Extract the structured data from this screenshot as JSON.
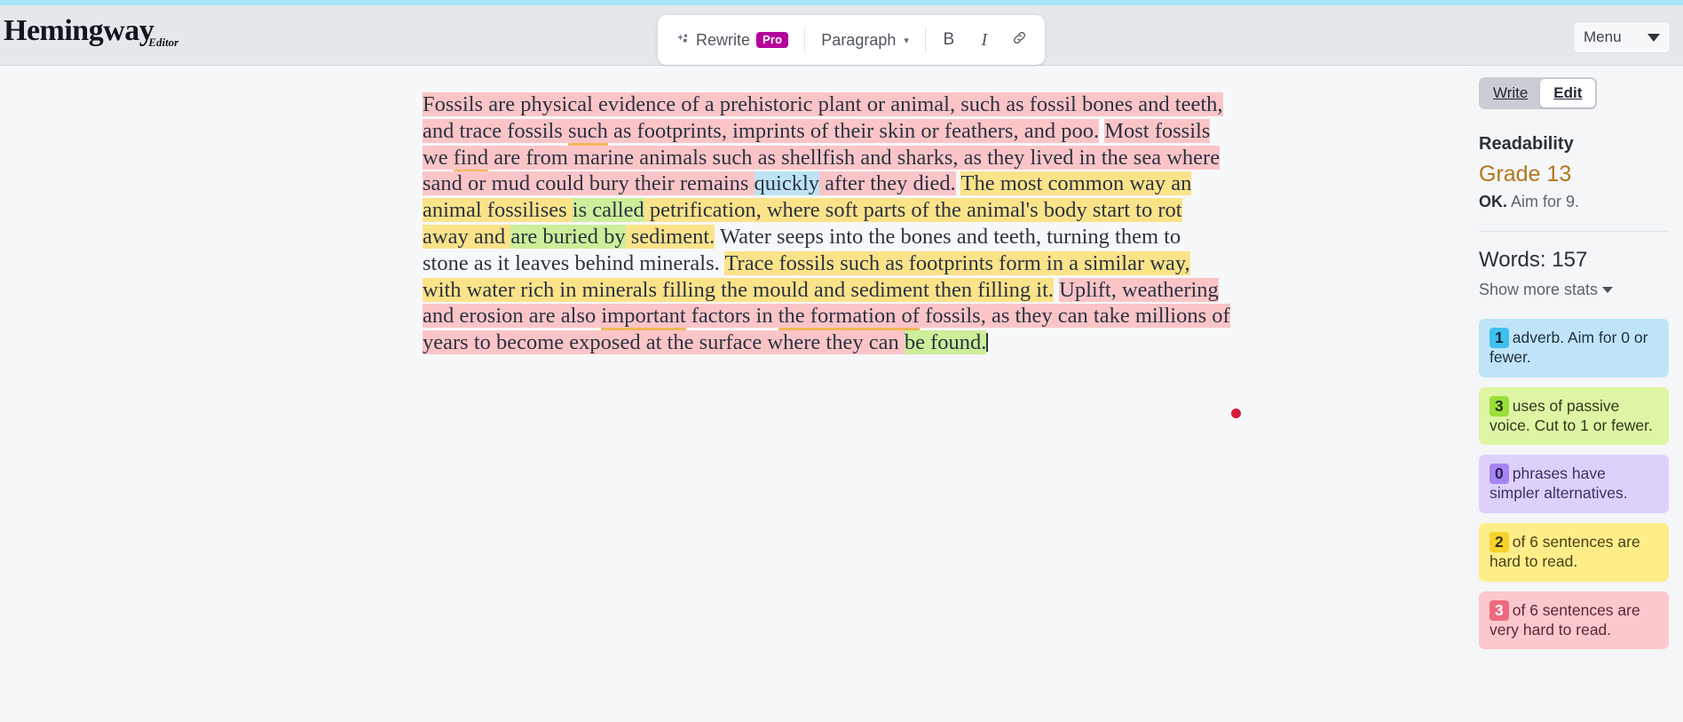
{
  "app": {
    "logo_name": "Hemingway",
    "logo_sub": "Editor"
  },
  "toolbar": {
    "rewrite_label": "Rewrite",
    "pro_badge": "Pro",
    "paragraph_label": "Paragraph",
    "bold_label": "B",
    "italic_label": "I",
    "link_icon": "link-icon",
    "sparkle_icon": "sparkle-icon",
    "chevron_icon": "chevron-down-icon"
  },
  "menu": {
    "label": "Menu"
  },
  "sidebar": {
    "toggle": {
      "write_label": "Write",
      "edit_label": "Edit",
      "active": "Edit"
    },
    "readability_title": "Readability",
    "grade": "Grade 13",
    "grade_status": "OK.",
    "grade_aim": "Aim for 9.",
    "words_label": "Words: 157",
    "show_more_label": "Show more stats",
    "cards": [
      {
        "count": "1",
        "text": "adverb. Aim for 0 or fewer.",
        "kind": "adverb"
      },
      {
        "count": "3",
        "text": "uses of passive voice. Cut to 1 or fewer.",
        "kind": "passive"
      },
      {
        "count": "0",
        "text": "phrases have simpler alternatives.",
        "kind": "simpler"
      },
      {
        "count": "2",
        "text": "of 6 sentences are hard to read.",
        "kind": "hard"
      },
      {
        "count": "3",
        "text": "of 6 sentences are very hard to read.",
        "kind": "vhard"
      }
    ]
  },
  "colors": {
    "very_hard": "#fbc5c8",
    "hard": "#fbe38a",
    "adverb": "#bde3f5",
    "passive": "#cdee9a",
    "simpler_underline": "#f0b858",
    "grade": "#b3761b",
    "pro_badge": "#b5009a",
    "accent_strip": "#a9e4f7",
    "cursor_dot": "#d61b37"
  },
  "document": {
    "segments": [
      {
        "text": "Fossils are physical evidence of a prehistoric plant or animal, such as fossil bones and teeth, and trace fossils ",
        "style": "very-hard"
      },
      {
        "text": "such",
        "style": "very-hard-underline"
      },
      {
        "text": " as footprints, imprints of their skin or feathers, and poo.",
        "style": "very-hard"
      },
      {
        "text": " ",
        "style": "none"
      },
      {
        "text": "Most fossils we ",
        "style": "very-hard"
      },
      {
        "text": "find",
        "style": "very-hard-underline"
      },
      {
        "text": " are from marine animals such as shellfish and sharks, as they lived in the sea where sand or mud could bury their remains ",
        "style": "very-hard"
      },
      {
        "text": "quickly",
        "style": "adverb"
      },
      {
        "text": " after they died.",
        "style": "very-hard"
      },
      {
        "text": " ",
        "style": "none"
      },
      {
        "text": "The most common way an animal fossilises ",
        "style": "hard"
      },
      {
        "text": "is called",
        "style": "passive"
      },
      {
        "text": " petrification, where soft parts of the animal's body start to rot away and ",
        "style": "hard"
      },
      {
        "text": "are buried by",
        "style": "passive"
      },
      {
        "text": " sediment.",
        "style": "hard"
      },
      {
        "text": " Water seeps into the bones and teeth, turning them to stone as it leaves behind minerals. ",
        "style": "none"
      },
      {
        "text": "Trace fossils such as footprints form in a similar way, with water rich in minerals filling the mould and sediment then filling it.",
        "style": "hard"
      },
      {
        "text": " ",
        "style": "none"
      },
      {
        "text": "Uplift, weathering and erosion are also ",
        "style": "very-hard"
      },
      {
        "text": "important",
        "style": "very-hard-underline"
      },
      {
        "text": " factors in ",
        "style": "very-hard"
      },
      {
        "text": "the formation of",
        "style": "very-hard-underline"
      },
      {
        "text": " fossils, as they can take millions of years to become exposed at the surface where they can ",
        "style": "very-hard"
      },
      {
        "text": "be found.",
        "style": "passive"
      }
    ]
  }
}
